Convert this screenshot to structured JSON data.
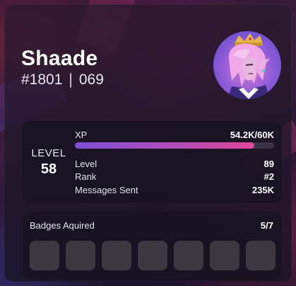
{
  "profile": {
    "username": "Shaade",
    "discriminator": "#1801",
    "id_number": "069",
    "separator": "|",
    "avatar_icon": "anime-character-avatar"
  },
  "stats": {
    "level_label": "LEVEL",
    "level_value": "58",
    "xp_label": "XP",
    "xp_value": "54.2K/60K",
    "xp_progress_fraction": 0.9,
    "rows": [
      {
        "label": "Level",
        "value": "89"
      },
      {
        "label": "Rank",
        "value": "#2"
      },
      {
        "label": "Messages Sent",
        "value": "235K"
      }
    ]
  },
  "badges": {
    "title": "Badges Aquired",
    "count": "5/7",
    "slot_count": 7
  },
  "colors": {
    "xp_gradient_start": "#7b4fd6",
    "xp_gradient_end": "#e0469a",
    "badge_slot": "#3b3842",
    "panel": "#16121f"
  }
}
